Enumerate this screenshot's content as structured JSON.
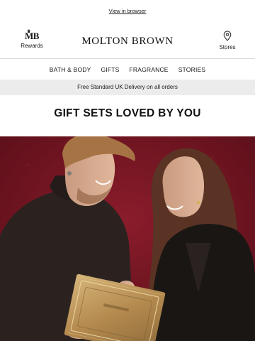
{
  "topbar": {
    "view_in_browser": "View in browser"
  },
  "header": {
    "rewards_logo": "MB",
    "rewards_label": "Rewards",
    "brand": "MOLTON BROWN",
    "stores_label": "Stores"
  },
  "nav": {
    "items": [
      "BATH & BODY",
      "GIFTS",
      "FRAGRANCE",
      "STORIES"
    ]
  },
  "banner": {
    "delivery": "Free Standard UK Delivery on all orders"
  },
  "main": {
    "headline": "GIFT SETS LOVED BY YOU"
  },
  "hero": {
    "description": "Man and woman smiling at each other holding a gold gift box against a deep red background"
  },
  "colors": {
    "hero_background": "#6e1420",
    "delivery_bar": "#ececec",
    "gift_box": "#b8955a"
  },
  "icons": {
    "rewards": "mb-crown-logo",
    "stores": "location-pin-icon"
  }
}
